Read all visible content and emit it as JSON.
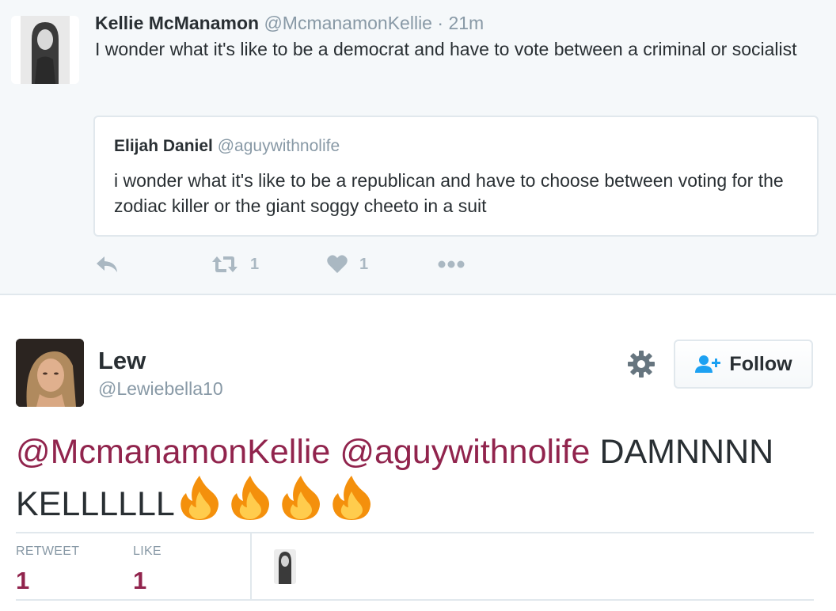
{
  "parent_tweet": {
    "author_name": "Kellie McManamon",
    "author_handle": "@McmanamonKellie",
    "separator": "·",
    "timestamp": "21m",
    "text": "I wonder what it's like to be a democrat and have to vote between a criminal or socialist",
    "quoted": {
      "author_name": "Elijah Daniel",
      "author_handle": "@aguywithnolife",
      "text": "i wonder what it's like to be a republican and have to choose between voting for the zodiac killer or the giant soggy cheeto in a suit"
    },
    "actions": {
      "reply_icon": "reply-icon",
      "retweet_icon": "retweet-icon",
      "retweet_count": "1",
      "like_icon": "heart-icon",
      "like_count": "1",
      "more_icon": "more-dots-icon"
    }
  },
  "reply_tweet": {
    "author_name": "Lew",
    "author_handle": "@Lewiebella10",
    "settings_icon": "gear-icon",
    "follow_label": "Follow",
    "follow_icon": "add-user-icon",
    "mention_1": "@McmanamonKellie",
    "mention_2": "@aguywithnolife",
    "text_part_1": "DAMNNNN",
    "text_part_2": "KELLLLLL",
    "emoji": "fire-emoji",
    "emoji_count": 4,
    "stats": {
      "retweet_label": "RETWEET",
      "retweet_value": "1",
      "like_label": "LIKE",
      "like_value": "1"
    }
  },
  "colors": {
    "mention": "#91244d",
    "secondary_text": "#8899a6",
    "primary_text": "#292f33",
    "follow_icon": "#1da1f2",
    "action_gray": "#aab8c2",
    "parent_background": "#f5f8fa"
  }
}
